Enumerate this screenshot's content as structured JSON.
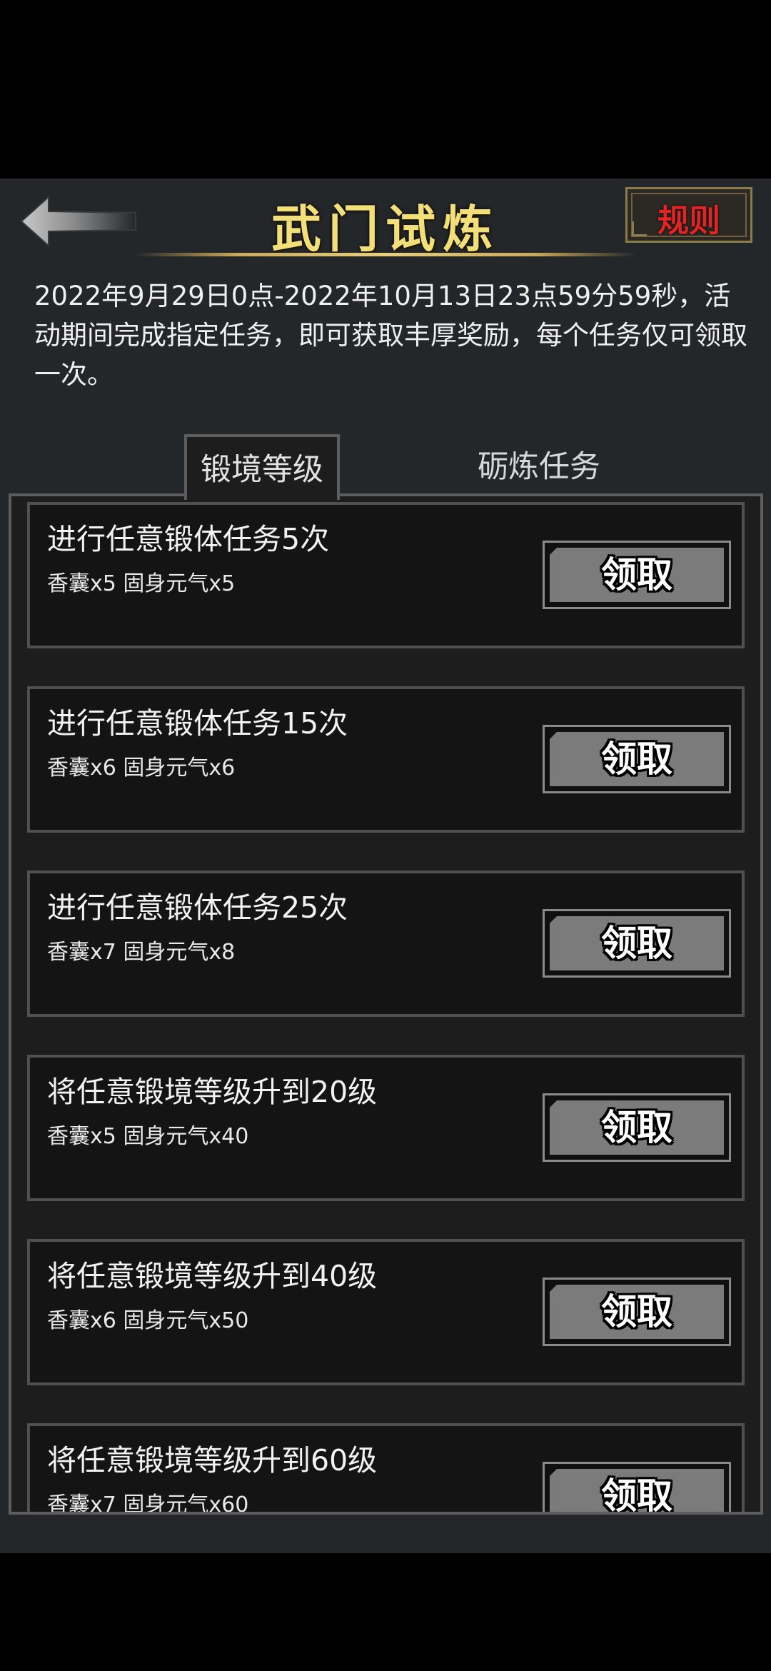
{
  "header": {
    "title": "武门试炼",
    "rules_label": "规则",
    "back_icon": "back-arrow-icon"
  },
  "description": "2022年9月29日0点-2022年10月13日23点59分59秒，活动期间完成指定任务，即可获取丰厚奖励，每个任务仅可领取一次。",
  "tabs": [
    {
      "label": "锻境等级",
      "active": true
    },
    {
      "label": "砺炼任务",
      "active": false
    }
  ],
  "tasks": [
    {
      "name": "进行任意锻体任务5次",
      "reward": "香囊x5 固身元气x5",
      "button": "领取"
    },
    {
      "name": "进行任意锻体任务15次",
      "reward": "香囊x6 固身元气x6",
      "button": "领取"
    },
    {
      "name": "进行任意锻体任务25次",
      "reward": "香囊x7 固身元气x8",
      "button": "领取"
    },
    {
      "name": "将任意锻境等级升到20级",
      "reward": "香囊x5 固身元气x40",
      "button": "领取"
    },
    {
      "name": "将任意锻境等级升到40级",
      "reward": "香囊x6 固身元气x50",
      "button": "领取"
    },
    {
      "name": "将任意锻境等级升到60级",
      "reward": "香囊x7 固身元气x60",
      "button": "领取"
    }
  ],
  "colors": {
    "title_gold": "#f3df7a",
    "rules_red": "#e12424",
    "button_gray": "#7b7b7b",
    "panel_bg": "#1d1d1d",
    "screen_bg": "#24272a"
  }
}
